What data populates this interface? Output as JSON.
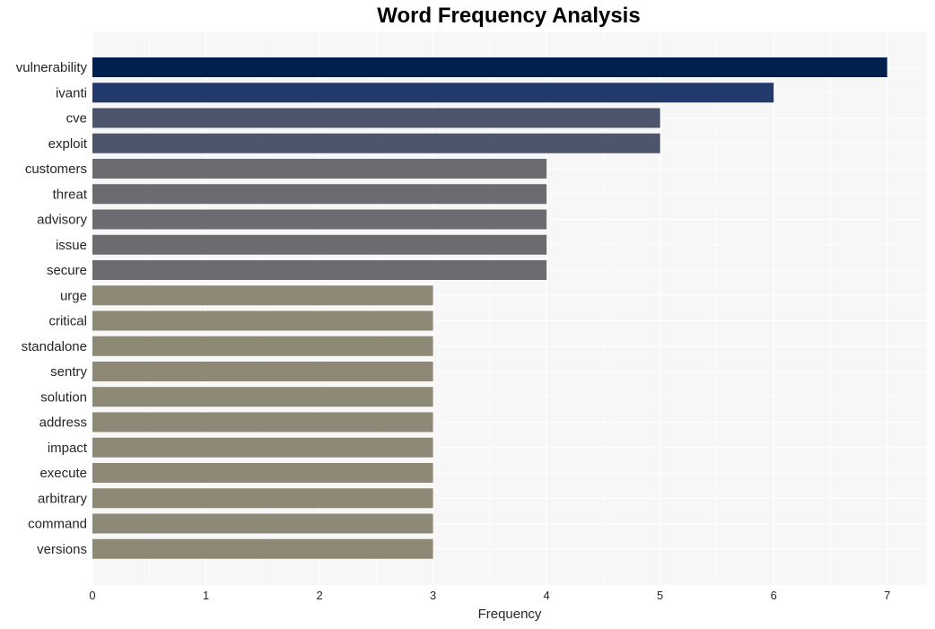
{
  "chart_data": {
    "type": "bar",
    "orientation": "horizontal",
    "title": "Word Frequency Analysis",
    "xlabel": "Frequency",
    "ylabel": "",
    "xlim": [
      0,
      7.35
    ],
    "xticks": [
      0,
      1,
      2,
      3,
      4,
      5,
      6,
      7
    ],
    "grid": true,
    "categories": [
      "vulnerability",
      "ivanti",
      "cve",
      "exploit",
      "customers",
      "threat",
      "advisory",
      "issue",
      "secure",
      "urge",
      "critical",
      "standalone",
      "sentry",
      "solution",
      "address",
      "impact",
      "execute",
      "arbitrary",
      "command",
      "versions"
    ],
    "values": [
      7,
      6,
      5,
      5,
      4,
      4,
      4,
      4,
      4,
      3,
      3,
      3,
      3,
      3,
      3,
      3,
      3,
      3,
      3,
      3
    ],
    "colors": {
      "7": "#00204e",
      "6": "#223b6c",
      "5": "#4c556b",
      "4": "#6b6c70",
      "3": "#8e8877"
    },
    "background": "#f7f7f7"
  }
}
